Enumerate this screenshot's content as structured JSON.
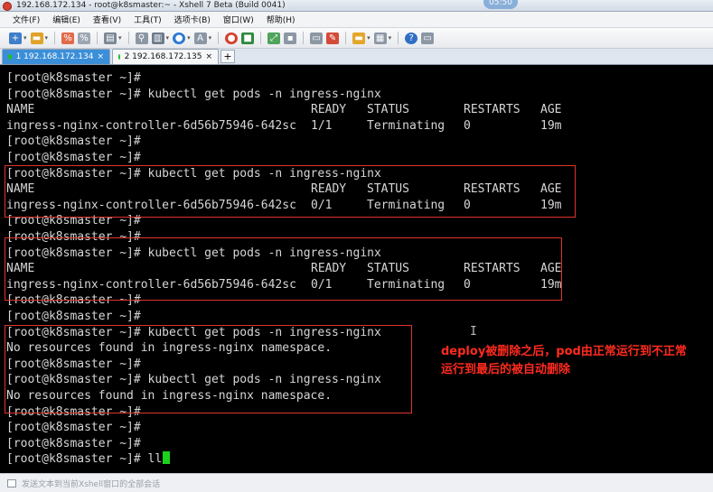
{
  "window": {
    "title": "192.168.172.134 - root@k8smaster:~ - Xshell 7 Beta (Build 0041)",
    "clock": "05:50"
  },
  "menu": [
    "文件(F)",
    "编辑(E)",
    "查看(V)",
    "工具(T)",
    "选项卡(B)",
    "窗口(W)",
    "帮助(H)"
  ],
  "tabs": [
    {
      "label": "1 192.168.172.134",
      "close": "×",
      "active": true
    },
    {
      "label": "2 192.168.172.135",
      "close": "×",
      "active": false
    }
  ],
  "tab_add_label": "+",
  "terminal": {
    "prompt": "[root@k8smaster ~]#",
    "command": "kubectl get pods -n ingress-nginx",
    "last_command": "ll",
    "headers": [
      "NAME",
      "READY",
      "STATUS",
      "RESTARTS",
      "AGE"
    ],
    "rows": [
      {
        "name": "ingress-nginx-controller-6d56b75946-642sc",
        "ready": "1/1",
        "status": "Terminating",
        "restarts": "0",
        "age": "19m"
      },
      {
        "name": "ingress-nginx-controller-6d56b75946-642sc",
        "ready": "0/1",
        "status": "Terminating",
        "restarts": "0",
        "age": "19m"
      },
      {
        "name": "ingress-nginx-controller-6d56b75946-642sc",
        "ready": "0/1",
        "status": "Terminating",
        "restarts": "0",
        "age": "19m"
      }
    ],
    "no_resources": "No resources found in ingress-nginx namespace."
  },
  "annotation": {
    "line1": "deploy被删除之后，pod由正常运行到不正常",
    "line2": "运行到最后的被自动删除"
  },
  "statusbar": {
    "placeholder": "发送文本到当前Xshell窗口的全部会话"
  },
  "colors": {
    "terminal_bg": "#000000",
    "terminal_text": "#d6d6d6",
    "cursor": "#1bd21b",
    "highlight_box": "#e0342a",
    "annotation": "#ff2b1f",
    "active_tab": "#3b8fd9"
  }
}
